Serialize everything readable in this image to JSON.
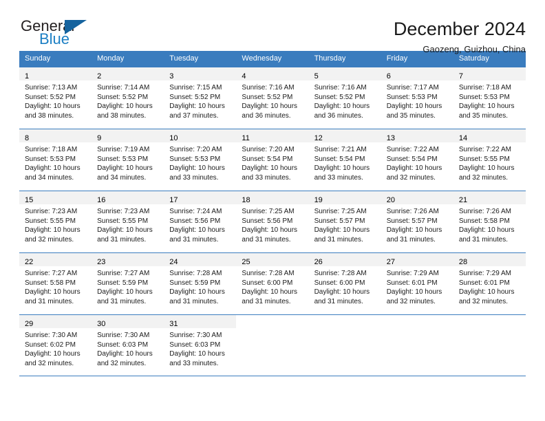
{
  "brand": {
    "name_top": "General",
    "name_bottom": "Blue",
    "accent_color": "#1c7fc4",
    "triangle_color": "#15639e"
  },
  "header": {
    "title": "December 2024",
    "subtitle": "Gaozeng, Guizhou, China"
  },
  "calendar": {
    "header_bg": "#3a7cbe",
    "daynum_bg": "#f2f2f2",
    "weekdays": [
      "Sunday",
      "Monday",
      "Tuesday",
      "Wednesday",
      "Thursday",
      "Friday",
      "Saturday"
    ],
    "weeks": [
      [
        {
          "day": "1",
          "sunrise": "Sunrise: 7:13 AM",
          "sunset": "Sunset: 5:52 PM",
          "daylight1": "Daylight: 10 hours",
          "daylight2": "and 38 minutes."
        },
        {
          "day": "2",
          "sunrise": "Sunrise: 7:14 AM",
          "sunset": "Sunset: 5:52 PM",
          "daylight1": "Daylight: 10 hours",
          "daylight2": "and 38 minutes."
        },
        {
          "day": "3",
          "sunrise": "Sunrise: 7:15 AM",
          "sunset": "Sunset: 5:52 PM",
          "daylight1": "Daylight: 10 hours",
          "daylight2": "and 37 minutes."
        },
        {
          "day": "4",
          "sunrise": "Sunrise: 7:16 AM",
          "sunset": "Sunset: 5:52 PM",
          "daylight1": "Daylight: 10 hours",
          "daylight2": "and 36 minutes."
        },
        {
          "day": "5",
          "sunrise": "Sunrise: 7:16 AM",
          "sunset": "Sunset: 5:52 PM",
          "daylight1": "Daylight: 10 hours",
          "daylight2": "and 36 minutes."
        },
        {
          "day": "6",
          "sunrise": "Sunrise: 7:17 AM",
          "sunset": "Sunset: 5:53 PM",
          "daylight1": "Daylight: 10 hours",
          "daylight2": "and 35 minutes."
        },
        {
          "day": "7",
          "sunrise": "Sunrise: 7:18 AM",
          "sunset": "Sunset: 5:53 PM",
          "daylight1": "Daylight: 10 hours",
          "daylight2": "and 35 minutes."
        }
      ],
      [
        {
          "day": "8",
          "sunrise": "Sunrise: 7:18 AM",
          "sunset": "Sunset: 5:53 PM",
          "daylight1": "Daylight: 10 hours",
          "daylight2": "and 34 minutes."
        },
        {
          "day": "9",
          "sunrise": "Sunrise: 7:19 AM",
          "sunset": "Sunset: 5:53 PM",
          "daylight1": "Daylight: 10 hours",
          "daylight2": "and 34 minutes."
        },
        {
          "day": "10",
          "sunrise": "Sunrise: 7:20 AM",
          "sunset": "Sunset: 5:53 PM",
          "daylight1": "Daylight: 10 hours",
          "daylight2": "and 33 minutes."
        },
        {
          "day": "11",
          "sunrise": "Sunrise: 7:20 AM",
          "sunset": "Sunset: 5:54 PM",
          "daylight1": "Daylight: 10 hours",
          "daylight2": "and 33 minutes."
        },
        {
          "day": "12",
          "sunrise": "Sunrise: 7:21 AM",
          "sunset": "Sunset: 5:54 PM",
          "daylight1": "Daylight: 10 hours",
          "daylight2": "and 33 minutes."
        },
        {
          "day": "13",
          "sunrise": "Sunrise: 7:22 AM",
          "sunset": "Sunset: 5:54 PM",
          "daylight1": "Daylight: 10 hours",
          "daylight2": "and 32 minutes."
        },
        {
          "day": "14",
          "sunrise": "Sunrise: 7:22 AM",
          "sunset": "Sunset: 5:55 PM",
          "daylight1": "Daylight: 10 hours",
          "daylight2": "and 32 minutes."
        }
      ],
      [
        {
          "day": "15",
          "sunrise": "Sunrise: 7:23 AM",
          "sunset": "Sunset: 5:55 PM",
          "daylight1": "Daylight: 10 hours",
          "daylight2": "and 32 minutes."
        },
        {
          "day": "16",
          "sunrise": "Sunrise: 7:23 AM",
          "sunset": "Sunset: 5:55 PM",
          "daylight1": "Daylight: 10 hours",
          "daylight2": "and 31 minutes."
        },
        {
          "day": "17",
          "sunrise": "Sunrise: 7:24 AM",
          "sunset": "Sunset: 5:56 PM",
          "daylight1": "Daylight: 10 hours",
          "daylight2": "and 31 minutes."
        },
        {
          "day": "18",
          "sunrise": "Sunrise: 7:25 AM",
          "sunset": "Sunset: 5:56 PM",
          "daylight1": "Daylight: 10 hours",
          "daylight2": "and 31 minutes."
        },
        {
          "day": "19",
          "sunrise": "Sunrise: 7:25 AM",
          "sunset": "Sunset: 5:57 PM",
          "daylight1": "Daylight: 10 hours",
          "daylight2": "and 31 minutes."
        },
        {
          "day": "20",
          "sunrise": "Sunrise: 7:26 AM",
          "sunset": "Sunset: 5:57 PM",
          "daylight1": "Daylight: 10 hours",
          "daylight2": "and 31 minutes."
        },
        {
          "day": "21",
          "sunrise": "Sunrise: 7:26 AM",
          "sunset": "Sunset: 5:58 PM",
          "daylight1": "Daylight: 10 hours",
          "daylight2": "and 31 minutes."
        }
      ],
      [
        {
          "day": "22",
          "sunrise": "Sunrise: 7:27 AM",
          "sunset": "Sunset: 5:58 PM",
          "daylight1": "Daylight: 10 hours",
          "daylight2": "and 31 minutes."
        },
        {
          "day": "23",
          "sunrise": "Sunrise: 7:27 AM",
          "sunset": "Sunset: 5:59 PM",
          "daylight1": "Daylight: 10 hours",
          "daylight2": "and 31 minutes."
        },
        {
          "day": "24",
          "sunrise": "Sunrise: 7:28 AM",
          "sunset": "Sunset: 5:59 PM",
          "daylight1": "Daylight: 10 hours",
          "daylight2": "and 31 minutes."
        },
        {
          "day": "25",
          "sunrise": "Sunrise: 7:28 AM",
          "sunset": "Sunset: 6:00 PM",
          "daylight1": "Daylight: 10 hours",
          "daylight2": "and 31 minutes."
        },
        {
          "day": "26",
          "sunrise": "Sunrise: 7:28 AM",
          "sunset": "Sunset: 6:00 PM",
          "daylight1": "Daylight: 10 hours",
          "daylight2": "and 31 minutes."
        },
        {
          "day": "27",
          "sunrise": "Sunrise: 7:29 AM",
          "sunset": "Sunset: 6:01 PM",
          "daylight1": "Daylight: 10 hours",
          "daylight2": "and 32 minutes."
        },
        {
          "day": "28",
          "sunrise": "Sunrise: 7:29 AM",
          "sunset": "Sunset: 6:01 PM",
          "daylight1": "Daylight: 10 hours",
          "daylight2": "and 32 minutes."
        }
      ],
      [
        {
          "day": "29",
          "sunrise": "Sunrise: 7:30 AM",
          "sunset": "Sunset: 6:02 PM",
          "daylight1": "Daylight: 10 hours",
          "daylight2": "and 32 minutes."
        },
        {
          "day": "30",
          "sunrise": "Sunrise: 7:30 AM",
          "sunset": "Sunset: 6:03 PM",
          "daylight1": "Daylight: 10 hours",
          "daylight2": "and 32 minutes."
        },
        {
          "day": "31",
          "sunrise": "Sunrise: 7:30 AM",
          "sunset": "Sunset: 6:03 PM",
          "daylight1": "Daylight: 10 hours",
          "daylight2": "and 33 minutes."
        },
        null,
        null,
        null,
        null
      ]
    ]
  }
}
